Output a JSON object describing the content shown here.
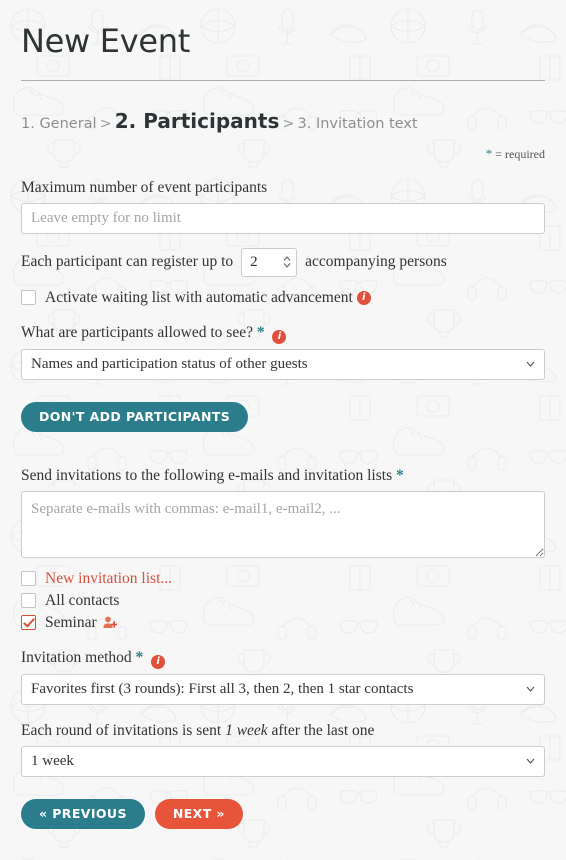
{
  "header": {
    "title": "New Event",
    "required_note_star": "*",
    "required_note_text": "= required"
  },
  "breadcrumb": {
    "steps": [
      {
        "label": "1. General",
        "active": false
      },
      {
        "label": "2. Participants",
        "active": true
      },
      {
        "label": "3. Invitation text",
        "active": false
      }
    ],
    "separator": ">"
  },
  "form": {
    "max_participants": {
      "label": "Maximum number of event participants",
      "value": "",
      "placeholder": "Leave empty for no limit"
    },
    "accompanying": {
      "text_before": "Each participant can register up to",
      "value": "2",
      "text_after": "accompanying persons"
    },
    "waiting_list": {
      "label": "Activate waiting list with automatic advancement",
      "checked": false,
      "info_icon": "info-icon"
    },
    "visibility": {
      "label": "What are participants allowed to see?",
      "required_star": "*",
      "info_icon": "info-icon",
      "selected": "Names and participation status of other guests",
      "options": [
        "Names and participation status of other guests"
      ]
    },
    "dont_add_button": "DON'T ADD PARTICIPANTS",
    "invitations": {
      "label": "Send invitations to the following e-mails and invitation lists",
      "required_star": "*",
      "value": "",
      "placeholder": "Separate e-mails with commas: e-mail1, e-mail2, ..."
    },
    "invitation_lists": [
      {
        "label": "New invitation list...",
        "checked": false,
        "accent": true,
        "icon": ""
      },
      {
        "label": "All contacts",
        "checked": false,
        "accent": false,
        "icon": ""
      },
      {
        "label": "Seminar",
        "checked": true,
        "accent": false,
        "icon": "person-add-icon"
      }
    ],
    "invitation_method": {
      "label": "Invitation method",
      "required_star": "*",
      "info_icon": "info-icon",
      "selected": "Favorites first (3 rounds): First all 3, then 2, then 1 star contacts",
      "options": [
        "Favorites first (3 rounds): First all 3, then 2, then 1 star contacts"
      ]
    },
    "round_interval": {
      "label_before": "Each round of invitations is sent",
      "label_emphasis": "1 week",
      "label_after": "after the last one",
      "selected": "1 week",
      "options": [
        "1 week"
      ]
    }
  },
  "nav": {
    "previous": "« PREVIOUS",
    "next": "NEXT »"
  },
  "colors": {
    "teal": "#2b7d8c",
    "orange": "#e8543a",
    "info_red": "#e1503a",
    "accent_red": "#d9503a",
    "background": "#f7f7f7"
  }
}
